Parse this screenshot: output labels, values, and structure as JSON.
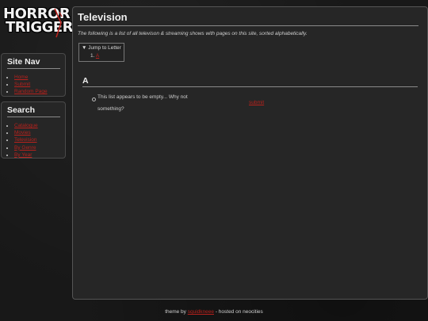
{
  "logo": {
    "line1": "HORROR",
    "line2": "TRIGGER"
  },
  "site_nav": {
    "title": "Site Nav",
    "items": [
      {
        "label": "Home"
      },
      {
        "label": "Submit"
      },
      {
        "label": "Random Page"
      }
    ]
  },
  "search": {
    "title": "Search",
    "items": [
      {
        "label": "Catalogue"
      },
      {
        "label": "Movies"
      },
      {
        "label": "Television"
      },
      {
        "label": "By Genre"
      },
      {
        "label": "By Year"
      }
    ]
  },
  "main": {
    "title": "Television",
    "intro": "The following is a list of all televison & streaming shows with pages on this site, sorted alphabetically.",
    "jump": {
      "summary": "Jump to Letter",
      "number": "1.",
      "letter": "A"
    },
    "section": "A",
    "empty_line1": "This list appears to be empty... Why not",
    "empty_line2": "something?",
    "submit_label": "submit"
  },
  "footer": {
    "prefix": "theme by",
    "author": "squidkneee",
    "suffix": "- hosted on neocities"
  },
  "colors": {
    "accent": "#b8211c",
    "background": "#181818",
    "panel": "#262626"
  }
}
